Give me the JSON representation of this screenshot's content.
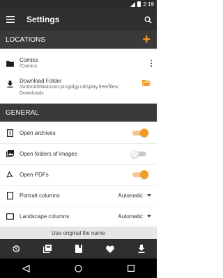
{
  "status_bar": {
    "time": "2:19",
    "icons": [
      "signal-icon",
      "battery-icon"
    ]
  },
  "app_bar": {
    "title": "Settings",
    "icons": [
      "menu-icon",
      "search-icon"
    ]
  },
  "locations": {
    "header": "LOCATIONS",
    "add_icon": "plus-icon",
    "accent_color": "#f59a23",
    "items": [
      {
        "name": "Comics",
        "path": "/Comics",
        "icon": "folder-icon"
      },
      {
        "name": "Download Folder",
        "path_line1": "/Android/data/com.progdigy.cdisplay.free/files/",
        "path_line2": "Downloads",
        "icon": "download-icon"
      }
    ]
  },
  "general": {
    "header": "GENERAL",
    "settings": [
      {
        "label": "Open archives",
        "type": "toggle",
        "value": true,
        "icon": "archive-icon"
      },
      {
        "label": "Open folders of images",
        "type": "toggle",
        "value": false,
        "icon": "image-icon"
      },
      {
        "label": "Open PDFs",
        "type": "toggle",
        "value": true,
        "icon": "pdf-icon"
      },
      {
        "label": "Portrait columns",
        "type": "select",
        "value": "Automatic",
        "icon": "portrait-icon"
      },
      {
        "label": "Landscape columns",
        "type": "select",
        "value": "Automatic",
        "icon": "landscape-icon"
      }
    ],
    "partial_item": "Use original file name"
  },
  "bottom_nav": [
    "history-icon",
    "library-icon",
    "book-icon",
    "favorite-icon",
    "download-icon"
  ],
  "system_nav": [
    "back-icon",
    "home-icon",
    "recents-icon"
  ]
}
